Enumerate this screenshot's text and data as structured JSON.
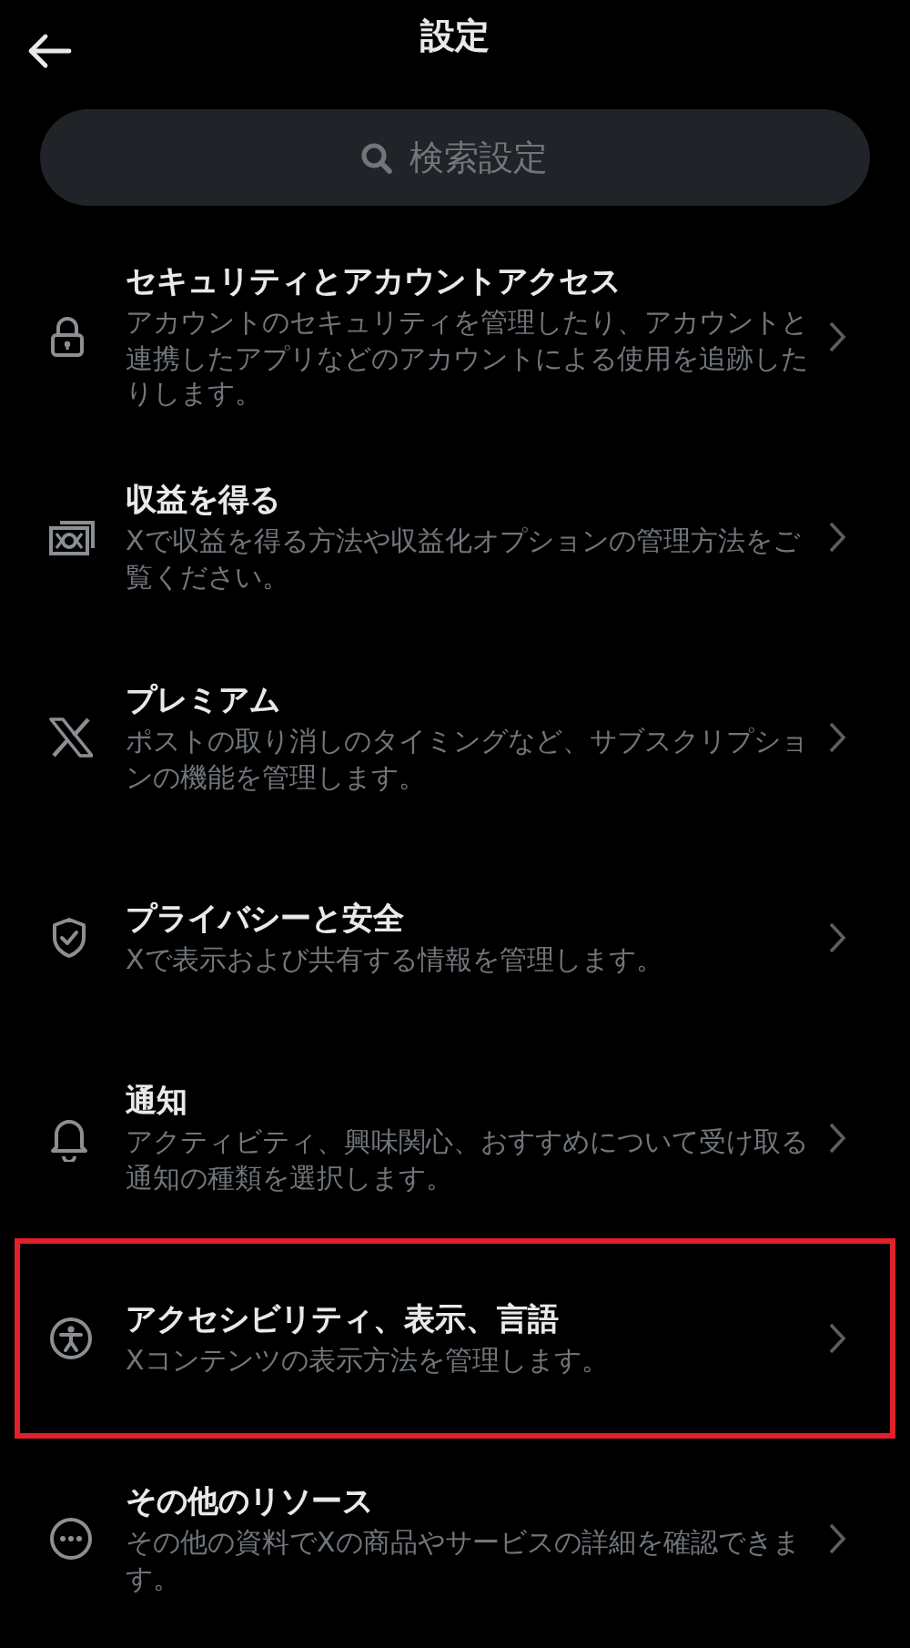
{
  "header": {
    "title": "設定"
  },
  "search": {
    "placeholder": "検索設定"
  },
  "items": [
    {
      "title": "セキュリティとアカウントアクセス",
      "description": "アカウントのセキュリティを管理したり、アカウントと連携したアプリなどのアカウントによる使用を追跡したりします。",
      "highlighted": false
    },
    {
      "title": "収益を得る",
      "description": "Xで収益を得る方法や収益化オプションの管理方法をご覧ください。",
      "highlighted": false
    },
    {
      "title": "プレミアム",
      "description": "ポストの取り消しのタイミングなど、サブスクリプションの機能を管理します。",
      "highlighted": false
    },
    {
      "title": "プライバシーと安全",
      "description": "Xで表示および共有する情報を管理します。",
      "highlighted": false
    },
    {
      "title": "通知",
      "description": "アクティビティ、興味関心、おすすめについて受け取る通知の種類を選択します。",
      "highlighted": false
    },
    {
      "title": "アクセシビリティ、表示、言語",
      "description": "Xコンテンツの表示方法を管理します。",
      "highlighted": true
    },
    {
      "title": "その他のリソース",
      "description": "その他の資料でXの商品やサービスの詳細を確認できます。",
      "highlighted": false
    }
  ]
}
